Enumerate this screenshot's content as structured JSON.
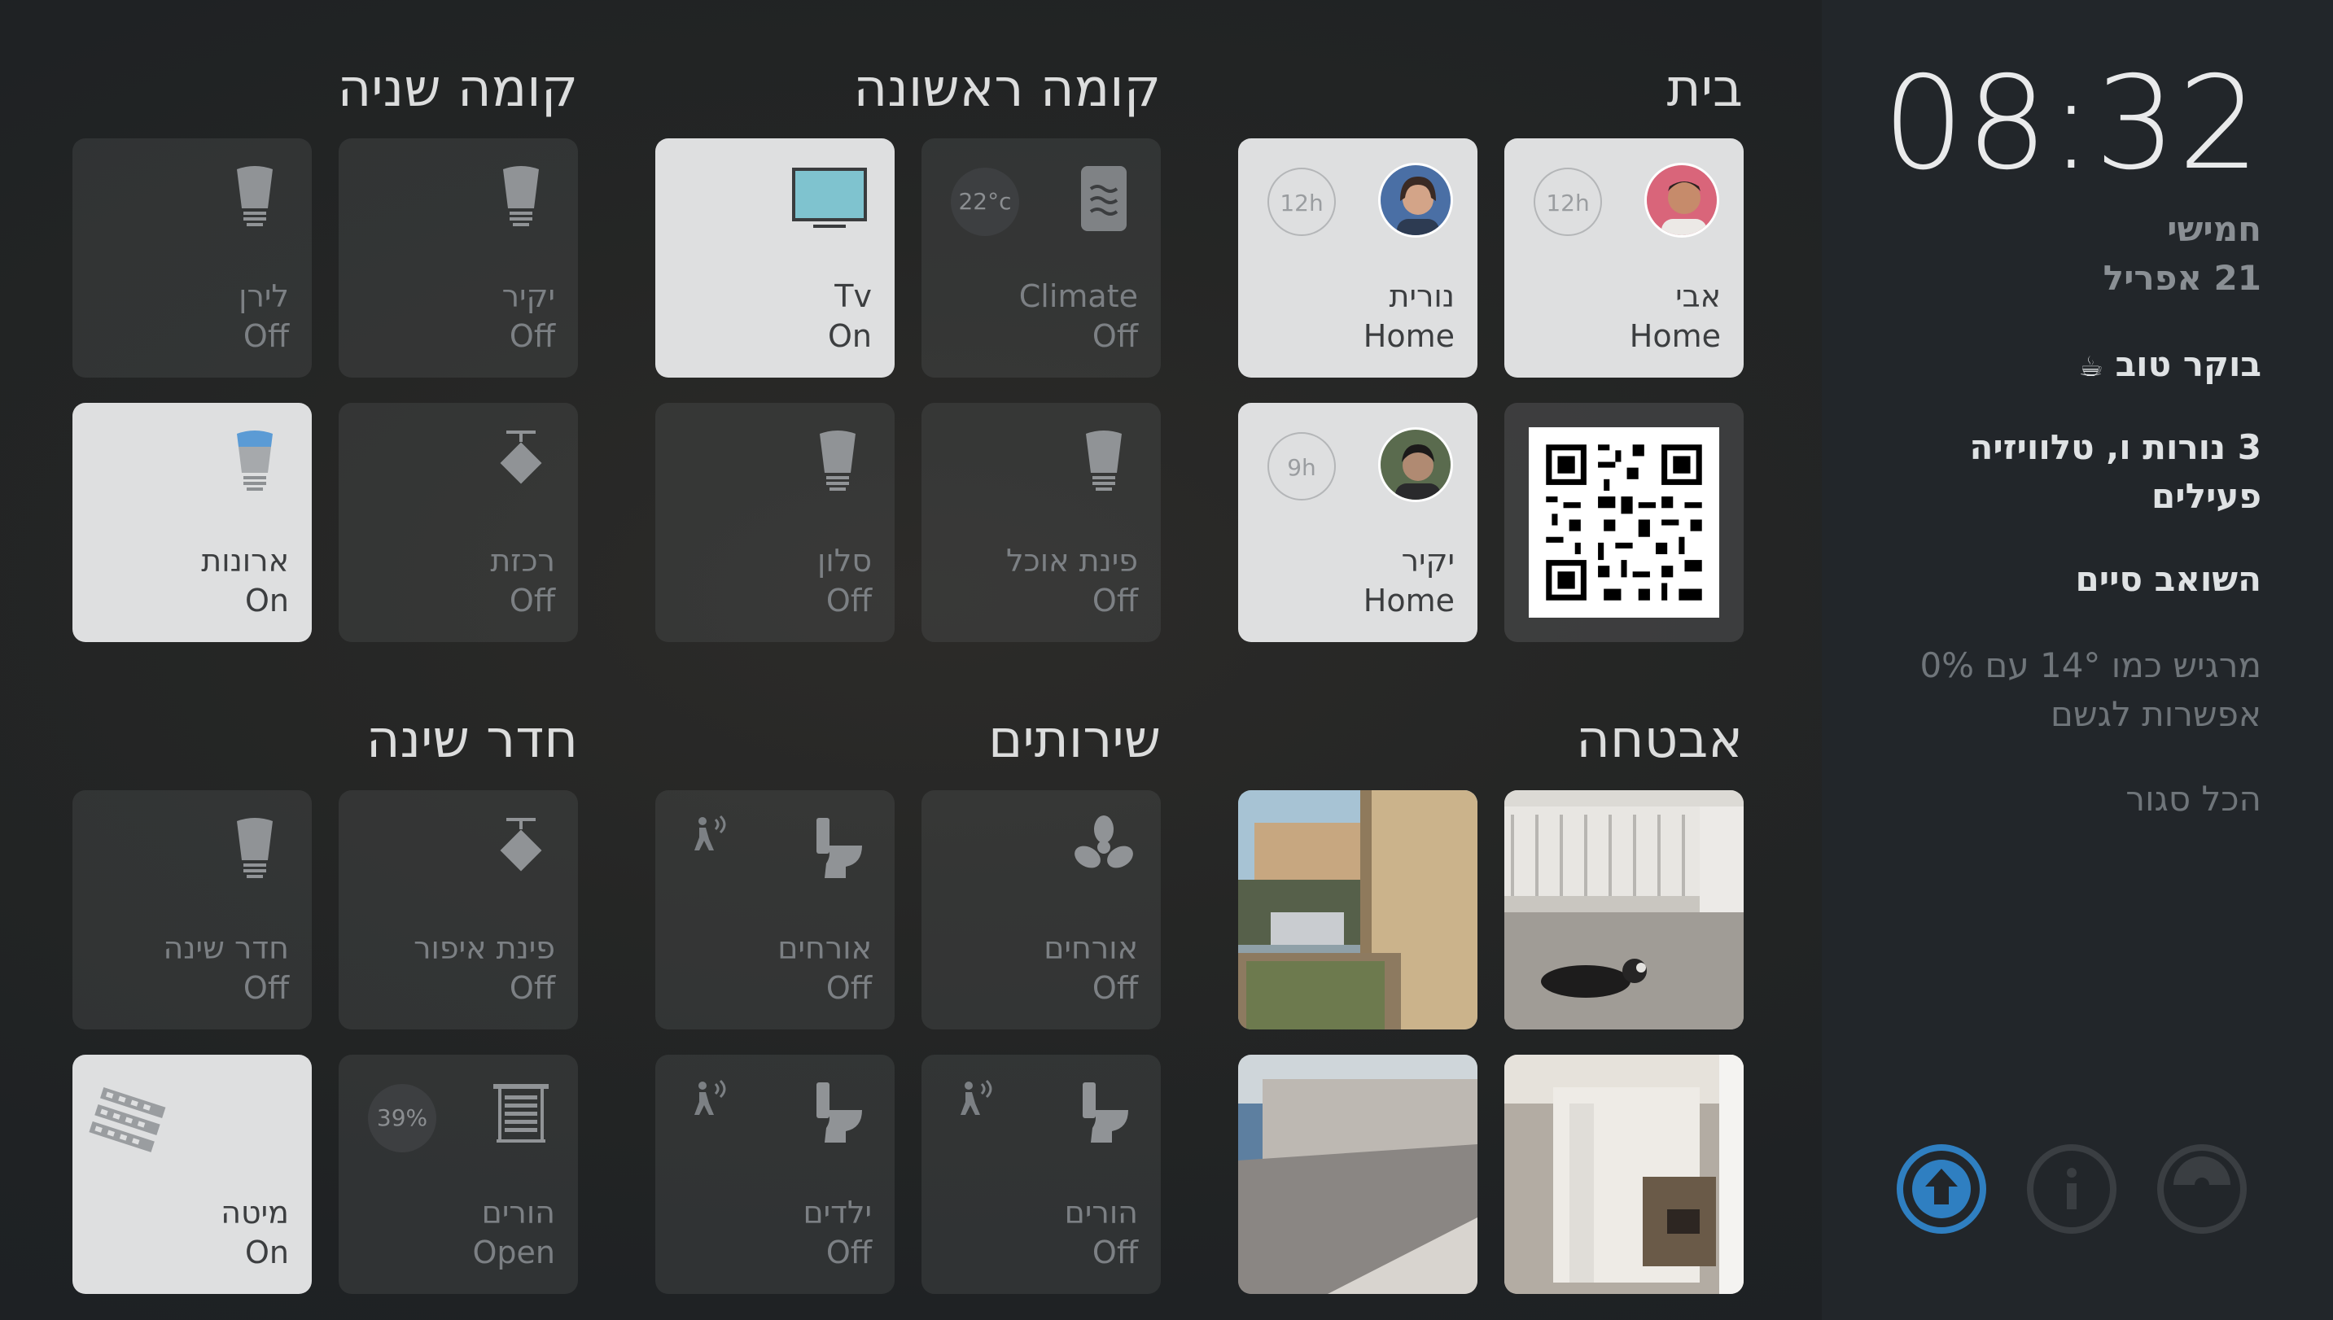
{
  "sidebar": {
    "time": "08:32",
    "day": "חמישי",
    "date": "21 אפריל",
    "greeting": "בוקר טוב",
    "greeting_icon": "coffee-icon",
    "lights_status_line1": "3 נורות ו, טלוויזיה",
    "lights_status_line2": "פעילים",
    "vacuum_status": "השואב סיים",
    "weather_line1": "מרגיש כמו 14° עם 0%",
    "weather_line2": "אפשרות לגשם",
    "doors_status": "הכל סגור",
    "buttons": [
      "upload-icon",
      "info-icon",
      "vacuum-icon"
    ]
  },
  "sections": {
    "home": "בית",
    "first_floor": "קומה ראשונה",
    "second_floor": "קומה שניה",
    "security": "אבטחה",
    "services": "שירותים",
    "bedroom": "חדר שינה"
  },
  "home_tiles": [
    {
      "name": "אבי",
      "state": "Home",
      "badge": "12h"
    },
    {
      "name": "נורית",
      "state": "Home",
      "badge": "12h"
    },
    {
      "name": "יקיר",
      "state": "Home",
      "badge": "9h"
    }
  ],
  "first_floor_tiles": [
    {
      "name": "Climate",
      "state": "Off",
      "badge": "22°c",
      "icon": "climate-icon"
    },
    {
      "name": "Tv",
      "state": "On",
      "icon": "tv-icon"
    },
    {
      "name": "פינת אוכל",
      "state": "Off",
      "icon": "bulb-icon"
    },
    {
      "name": "סלון",
      "state": "Off",
      "icon": "bulb-icon"
    }
  ],
  "second_floor_tiles": [
    {
      "name": "יקיר",
      "state": "Off",
      "icon": "bulb-icon"
    },
    {
      "name": "לירן",
      "state": "Off",
      "icon": "bulb-icon"
    },
    {
      "name": "רכזת",
      "state": "Off",
      "icon": "spotlight-icon"
    },
    {
      "name": "ארונות",
      "state": "On",
      "icon": "bulb-icon"
    }
  ],
  "services_tiles": [
    {
      "name": "אורחים",
      "state": "Off",
      "icon": "fan-icon"
    },
    {
      "name": "אורחים",
      "state": "Off",
      "icon": "toilet-icon"
    },
    {
      "name": "הורים",
      "state": "Off",
      "icon": "toilet-icon"
    },
    {
      "name": "ילדים",
      "state": "Off",
      "icon": "toilet-icon"
    }
  ],
  "bedroom_tiles": [
    {
      "name": "פינת איפור",
      "state": "Off",
      "icon": "spotlight-icon"
    },
    {
      "name": "חדר שינה",
      "state": "Off",
      "icon": "bulb-icon"
    },
    {
      "name": "הורים",
      "state": "Open",
      "badge": "39%",
      "icon": "blinds-icon"
    },
    {
      "name": "מיטה",
      "state": "On",
      "icon": "led-strip-icon"
    }
  ],
  "colors": {
    "accent": "#2f7fc1",
    "tile_on": "#dedfe0",
    "bulb_on": "#5b9bd5"
  }
}
